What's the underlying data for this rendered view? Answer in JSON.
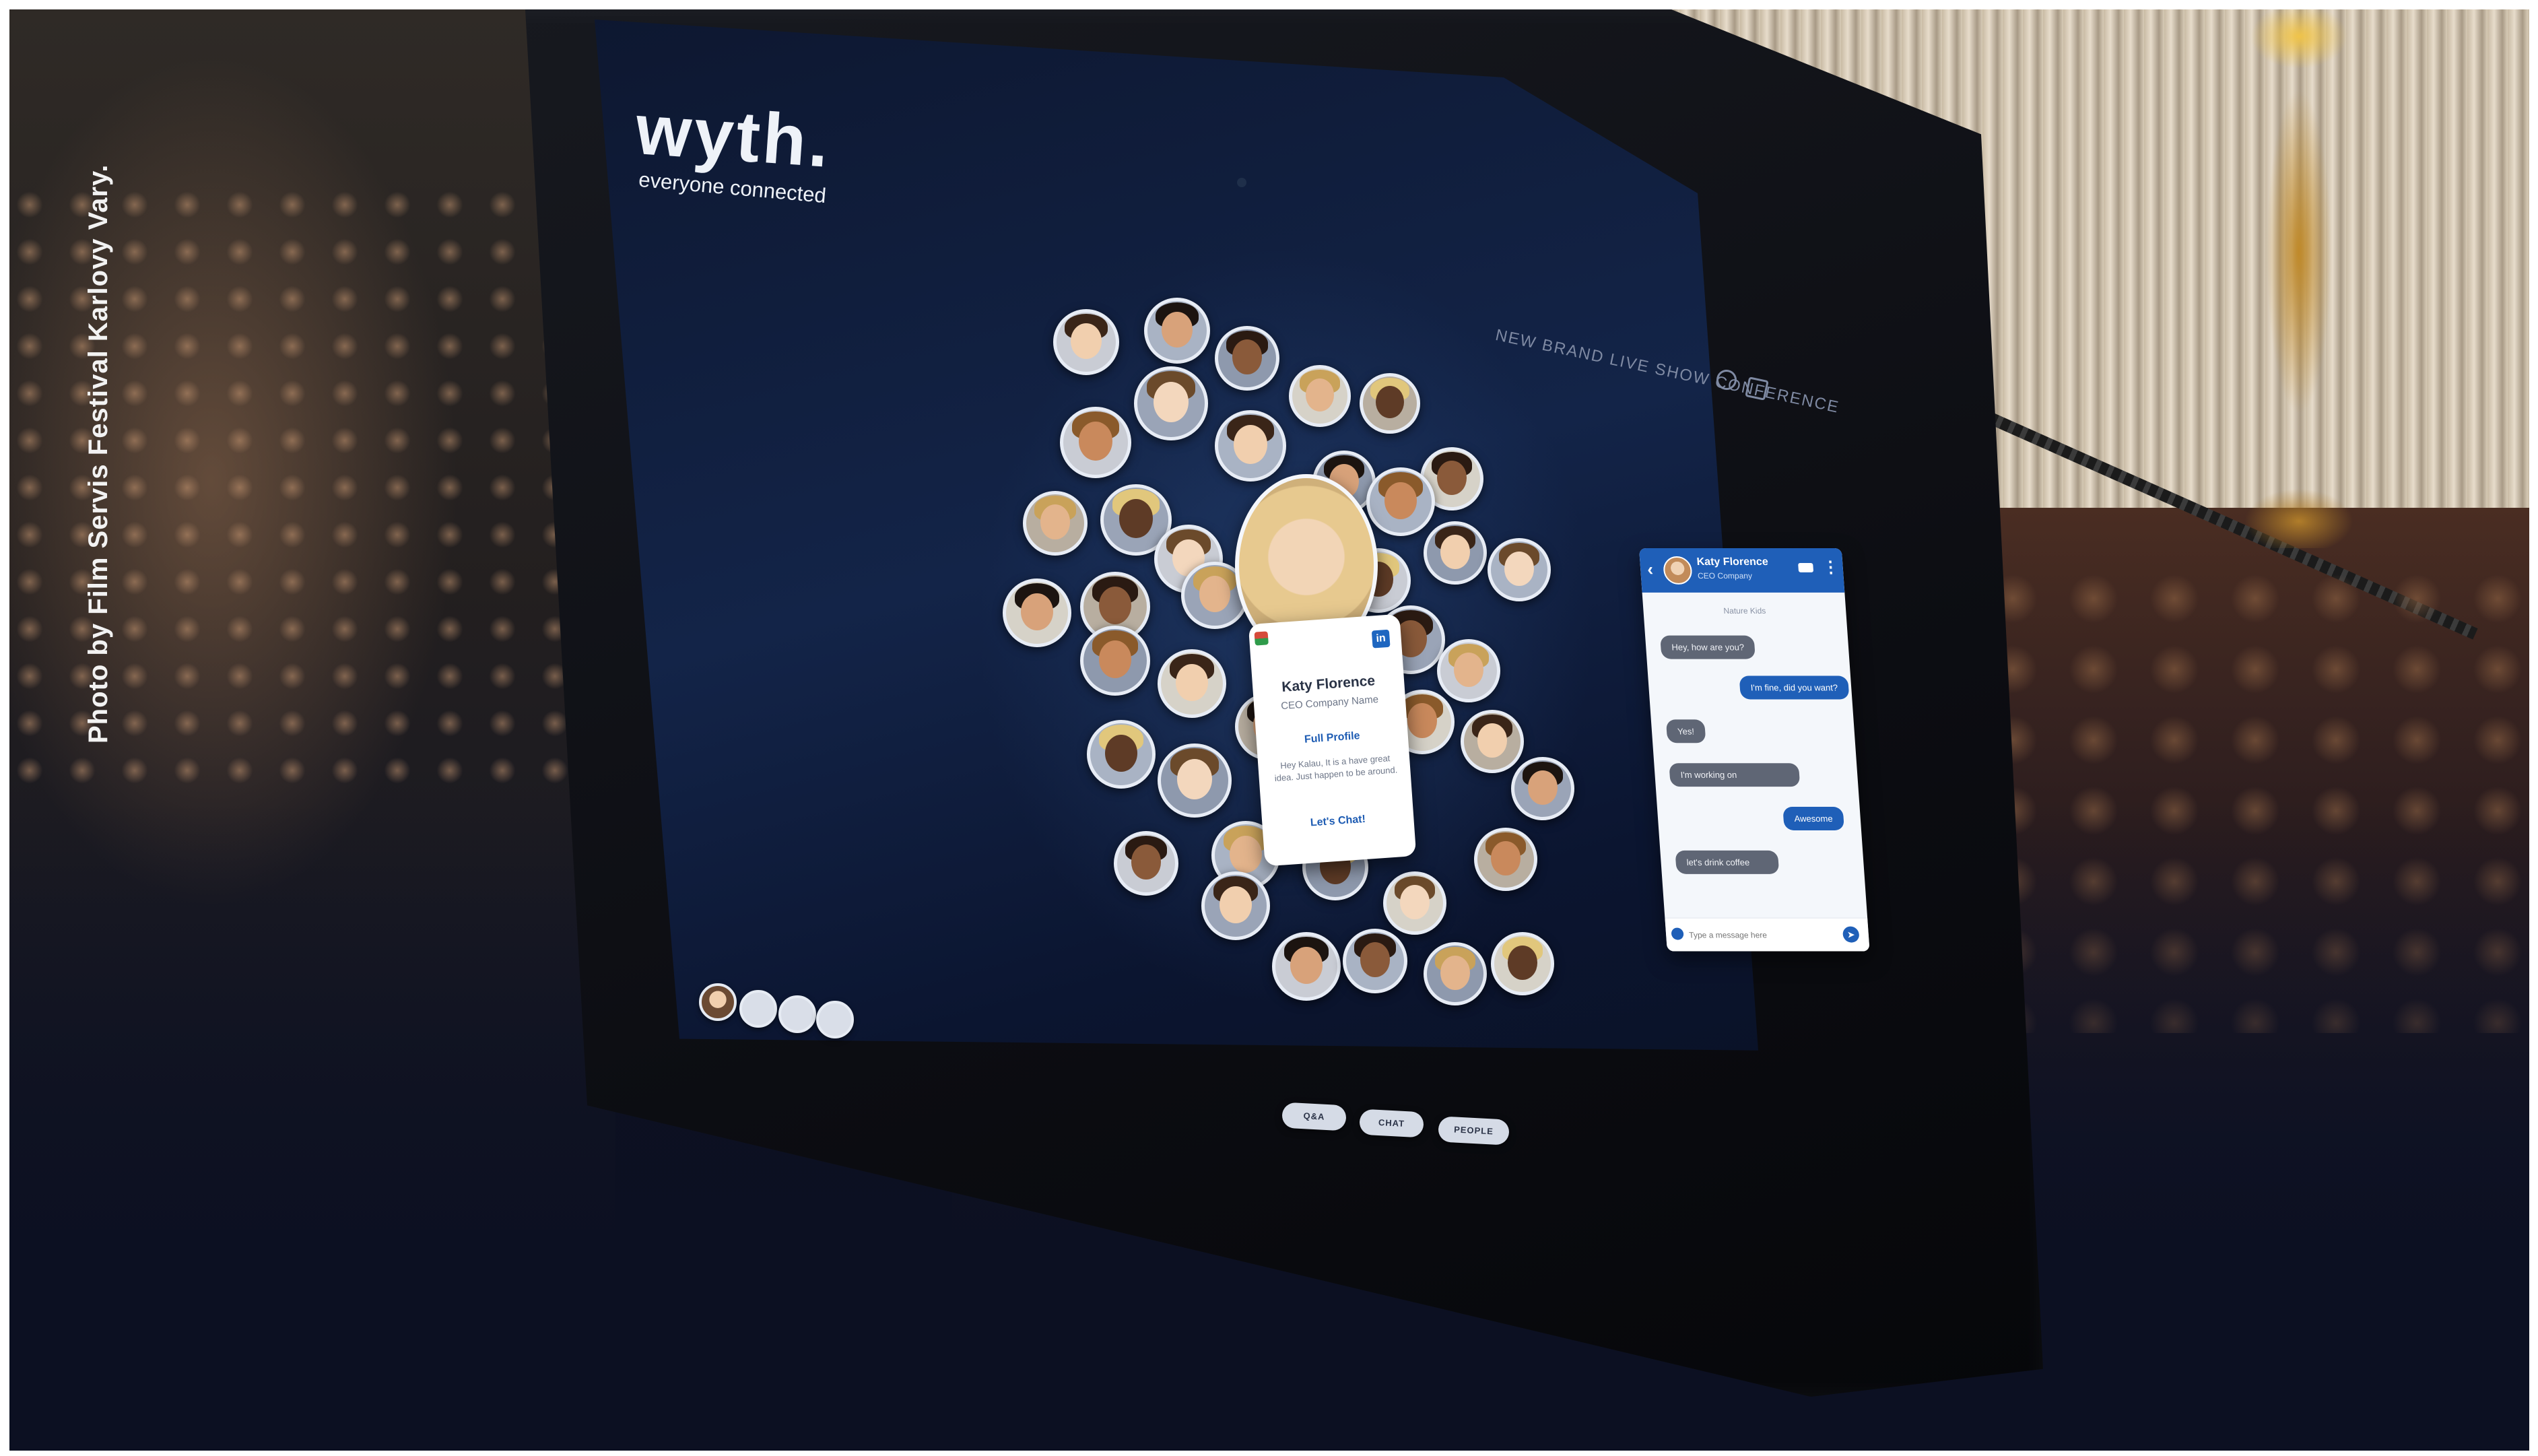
{
  "photo_credit": "Photo by Film Servis Festival Karlovy Vary.",
  "app": {
    "logo": "wyth.",
    "tagline": "everyone connected",
    "event_title": "NEW BRAND LIVE SHOW CONFERENCE"
  },
  "profile_card": {
    "name": "Katy Florence",
    "company": "CEO Company Name",
    "full_profile_label": "Full Profile",
    "message": "Hey Kalau, It is a have great idea. Just happen to be around.",
    "cta_label": "Let's Chat!"
  },
  "chat": {
    "contact_name": "Katy Florence",
    "contact_subtitle": "CEO Company",
    "day_label": "Nature Kids",
    "messages": [
      {
        "from": "them",
        "text": "Hey, how are you?"
      },
      {
        "from": "me",
        "text": "I'm fine, did you want?"
      },
      {
        "from": "them",
        "text": "Yes!"
      },
      {
        "from": "them",
        "text": "I'm working on"
      },
      {
        "from": "me",
        "text": "Awesome"
      },
      {
        "from": "them",
        "text": "let's drink coffee"
      }
    ],
    "input_placeholder": "Type a message here"
  },
  "nav": {
    "qa_label": "Q&A",
    "chat_label": "CHAT",
    "people_label": "PEOPLE"
  },
  "colors": {
    "accent_blue": "#1f5fb8",
    "screen_bg": "#132448",
    "linkedin_blue": "#1e66c0"
  }
}
